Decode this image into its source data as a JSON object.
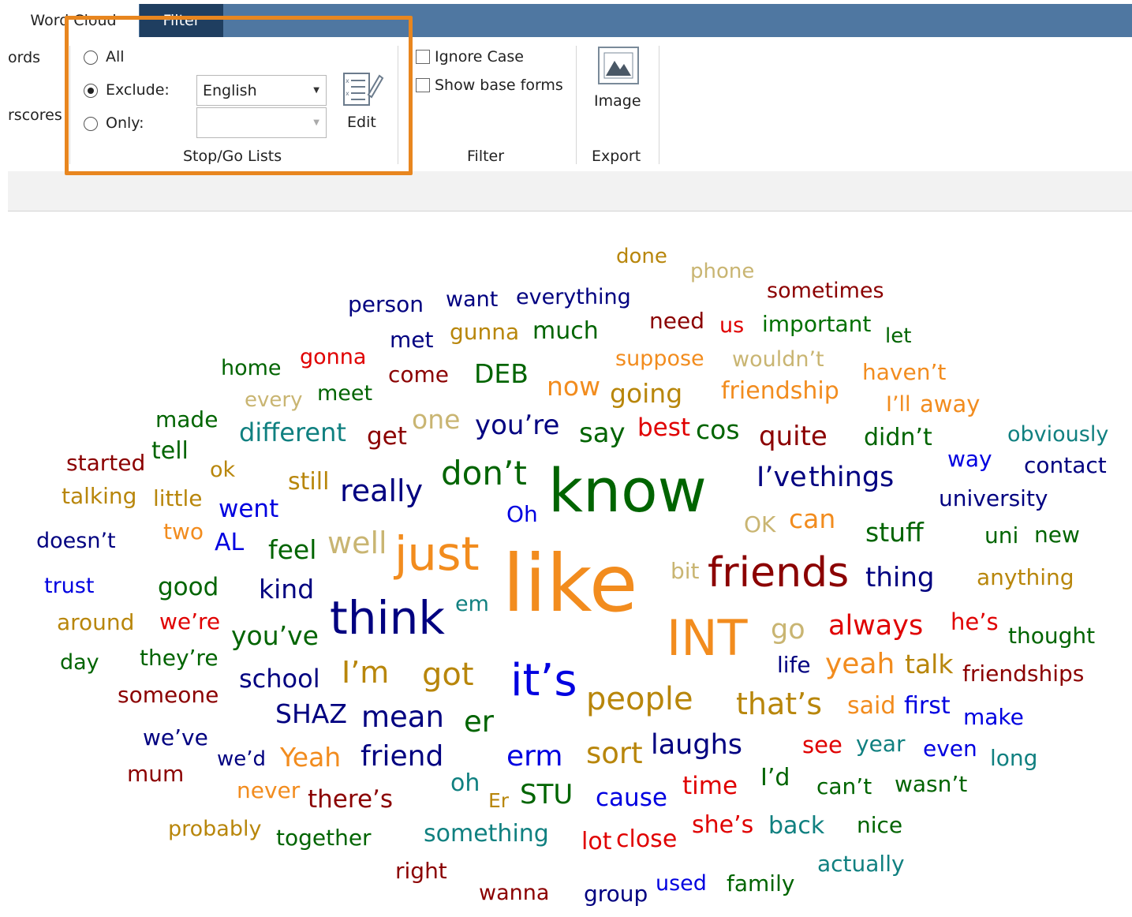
{
  "tabs": {
    "word_cloud": "Word Cloud",
    "filter": "Filter"
  },
  "ribbon": {
    "left_partial_1": "ords",
    "left_partial_2": "rscores",
    "stop_go": {
      "all": "All",
      "exclude": "Exclude:",
      "only": "Only:",
      "exclude_value": "English",
      "only_value": "",
      "selected": "Exclude:",
      "edit": "Edit",
      "group_label": "Stop/Go Lists"
    },
    "filter": {
      "ignore_case": "Ignore Case",
      "ignore_case_checked": false,
      "show_base_forms": "Show base forms",
      "show_base_forms_checked": false,
      "group_label": "Filter"
    },
    "export": {
      "image": "Image",
      "group_label": "Export"
    }
  },
  "colors": {
    "highlight": "#e8861f",
    "titlebar": "#4f77a1",
    "active_tab": "#1f3e60"
  },
  "cloud_words": [
    "done",
    "phone",
    "sometimes",
    "person",
    "want",
    "everything",
    "need",
    "us",
    "important",
    "let",
    "met",
    "gunna",
    "much",
    "home",
    "gonna",
    "come",
    "DEB",
    "suppose",
    "wouldn’t",
    "haven’t",
    "every",
    "meet",
    "now",
    "going",
    "friendship",
    "I’ll",
    "away",
    "made",
    "different",
    "one",
    "get",
    "you’re",
    "say",
    "best",
    "cos",
    "quite",
    "didn’t",
    "obviously",
    "started",
    "tell",
    "ok",
    "still",
    "don’t",
    "way",
    "contact",
    "talking",
    "little",
    "really",
    "know",
    "I’ve",
    "things",
    "university",
    "went",
    "Oh",
    "OK",
    "can",
    "doesn’t",
    "two",
    "AL",
    "feel",
    "well",
    "stuff",
    "uni",
    "new",
    "just",
    "bit",
    "friends",
    "thing",
    "anything",
    "trust",
    "good",
    "kind",
    "like",
    "around",
    "we’re",
    "think",
    "em",
    "INT",
    "always",
    "he’s",
    "thought",
    "go",
    "day",
    "they’re",
    "you’ve",
    "life",
    "yeah",
    "talk",
    "friendships",
    "school",
    "I’m",
    "got",
    "it’s",
    "someone",
    "people",
    "that’s",
    "said",
    "first",
    "SHAZ",
    "mean",
    "er",
    "make",
    "we’ve",
    "see",
    "year",
    "even",
    "laughs",
    "we’d",
    "Yeah",
    "friend",
    "erm",
    "sort",
    "long",
    "mum",
    "I’d",
    "oh",
    "time",
    "can’t",
    "wasn’t",
    "never",
    "Er",
    "STU",
    "cause",
    "there’s",
    "she’s",
    "back",
    "nice",
    "probably",
    "something",
    "lot",
    "close",
    "together",
    "actually",
    "right",
    "used",
    "family",
    "wanna",
    "group"
  ]
}
